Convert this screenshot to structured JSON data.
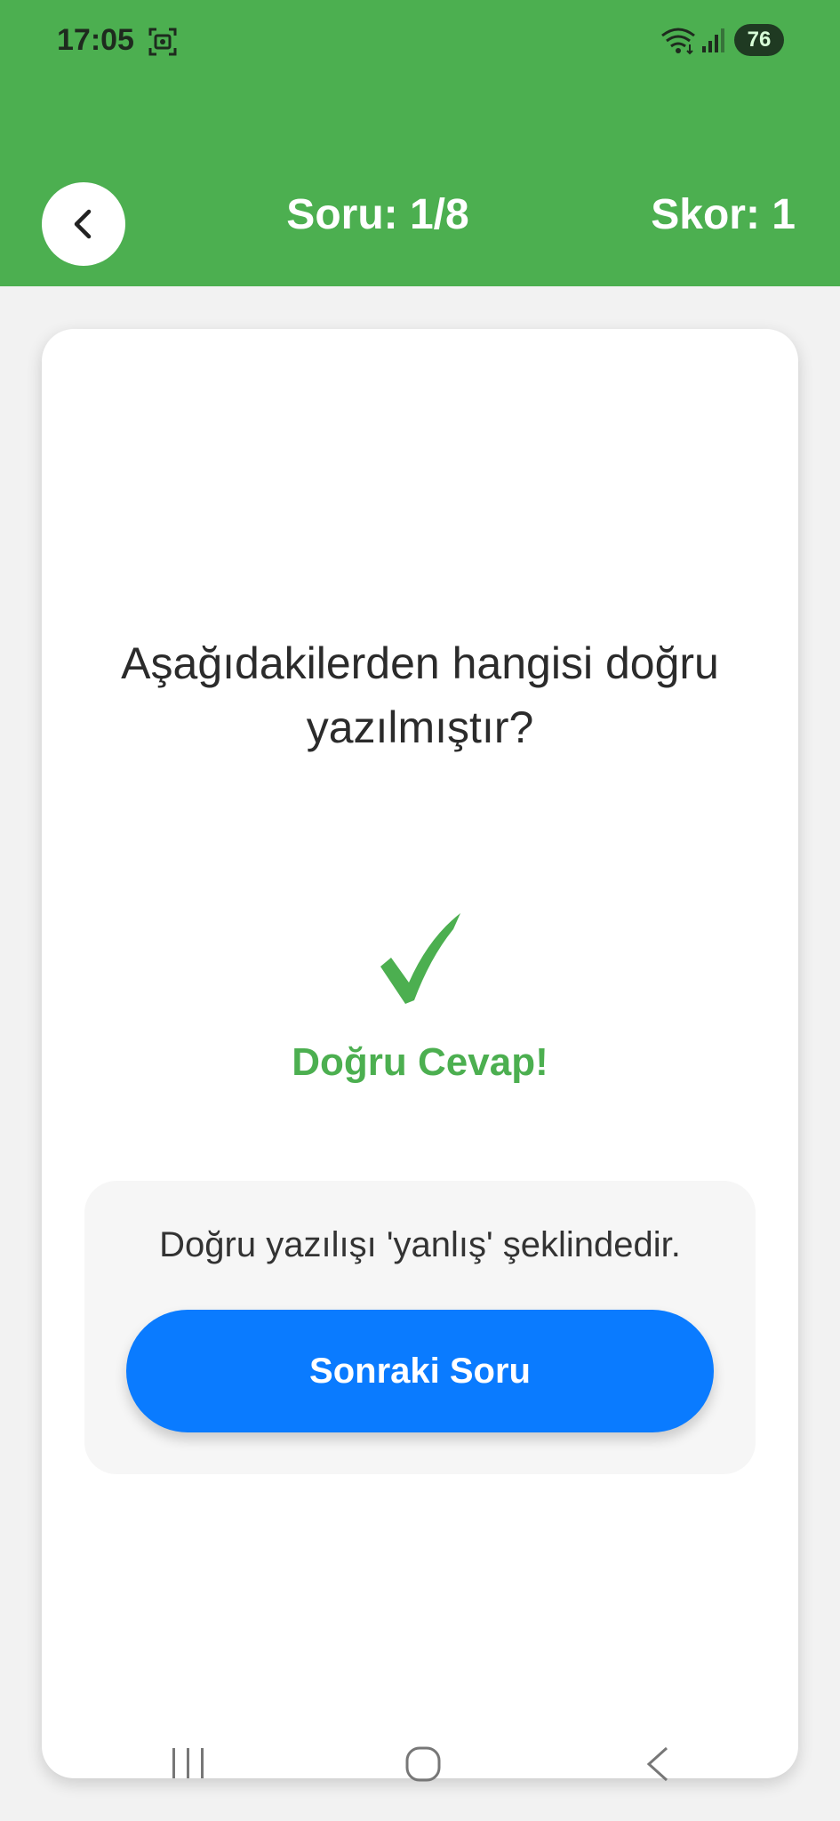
{
  "status_bar": {
    "time": "17:05",
    "battery": "76",
    "icons": [
      "screenshot-icon",
      "wifi-icon",
      "signal-icon"
    ]
  },
  "header": {
    "question_counter": "Soru: 1/8",
    "score": "Skor: 1",
    "back_icon": "chevron-left-icon",
    "background_color": "#4caf50"
  },
  "card": {
    "question": "Aşağıdakilerden hangisi doğru yazılmıştır?",
    "result_icon": "check-icon",
    "result_text": "Doğru Cevap!",
    "result_color": "#4caf50",
    "explanation": "Doğru yazılışı 'yanlış' şeklindedir.",
    "next_button_label": "Sonraki Soru",
    "next_button_color": "#0a7bff"
  },
  "nav_bar": {
    "icons": [
      "recents-icon",
      "home-icon",
      "back-icon"
    ]
  }
}
